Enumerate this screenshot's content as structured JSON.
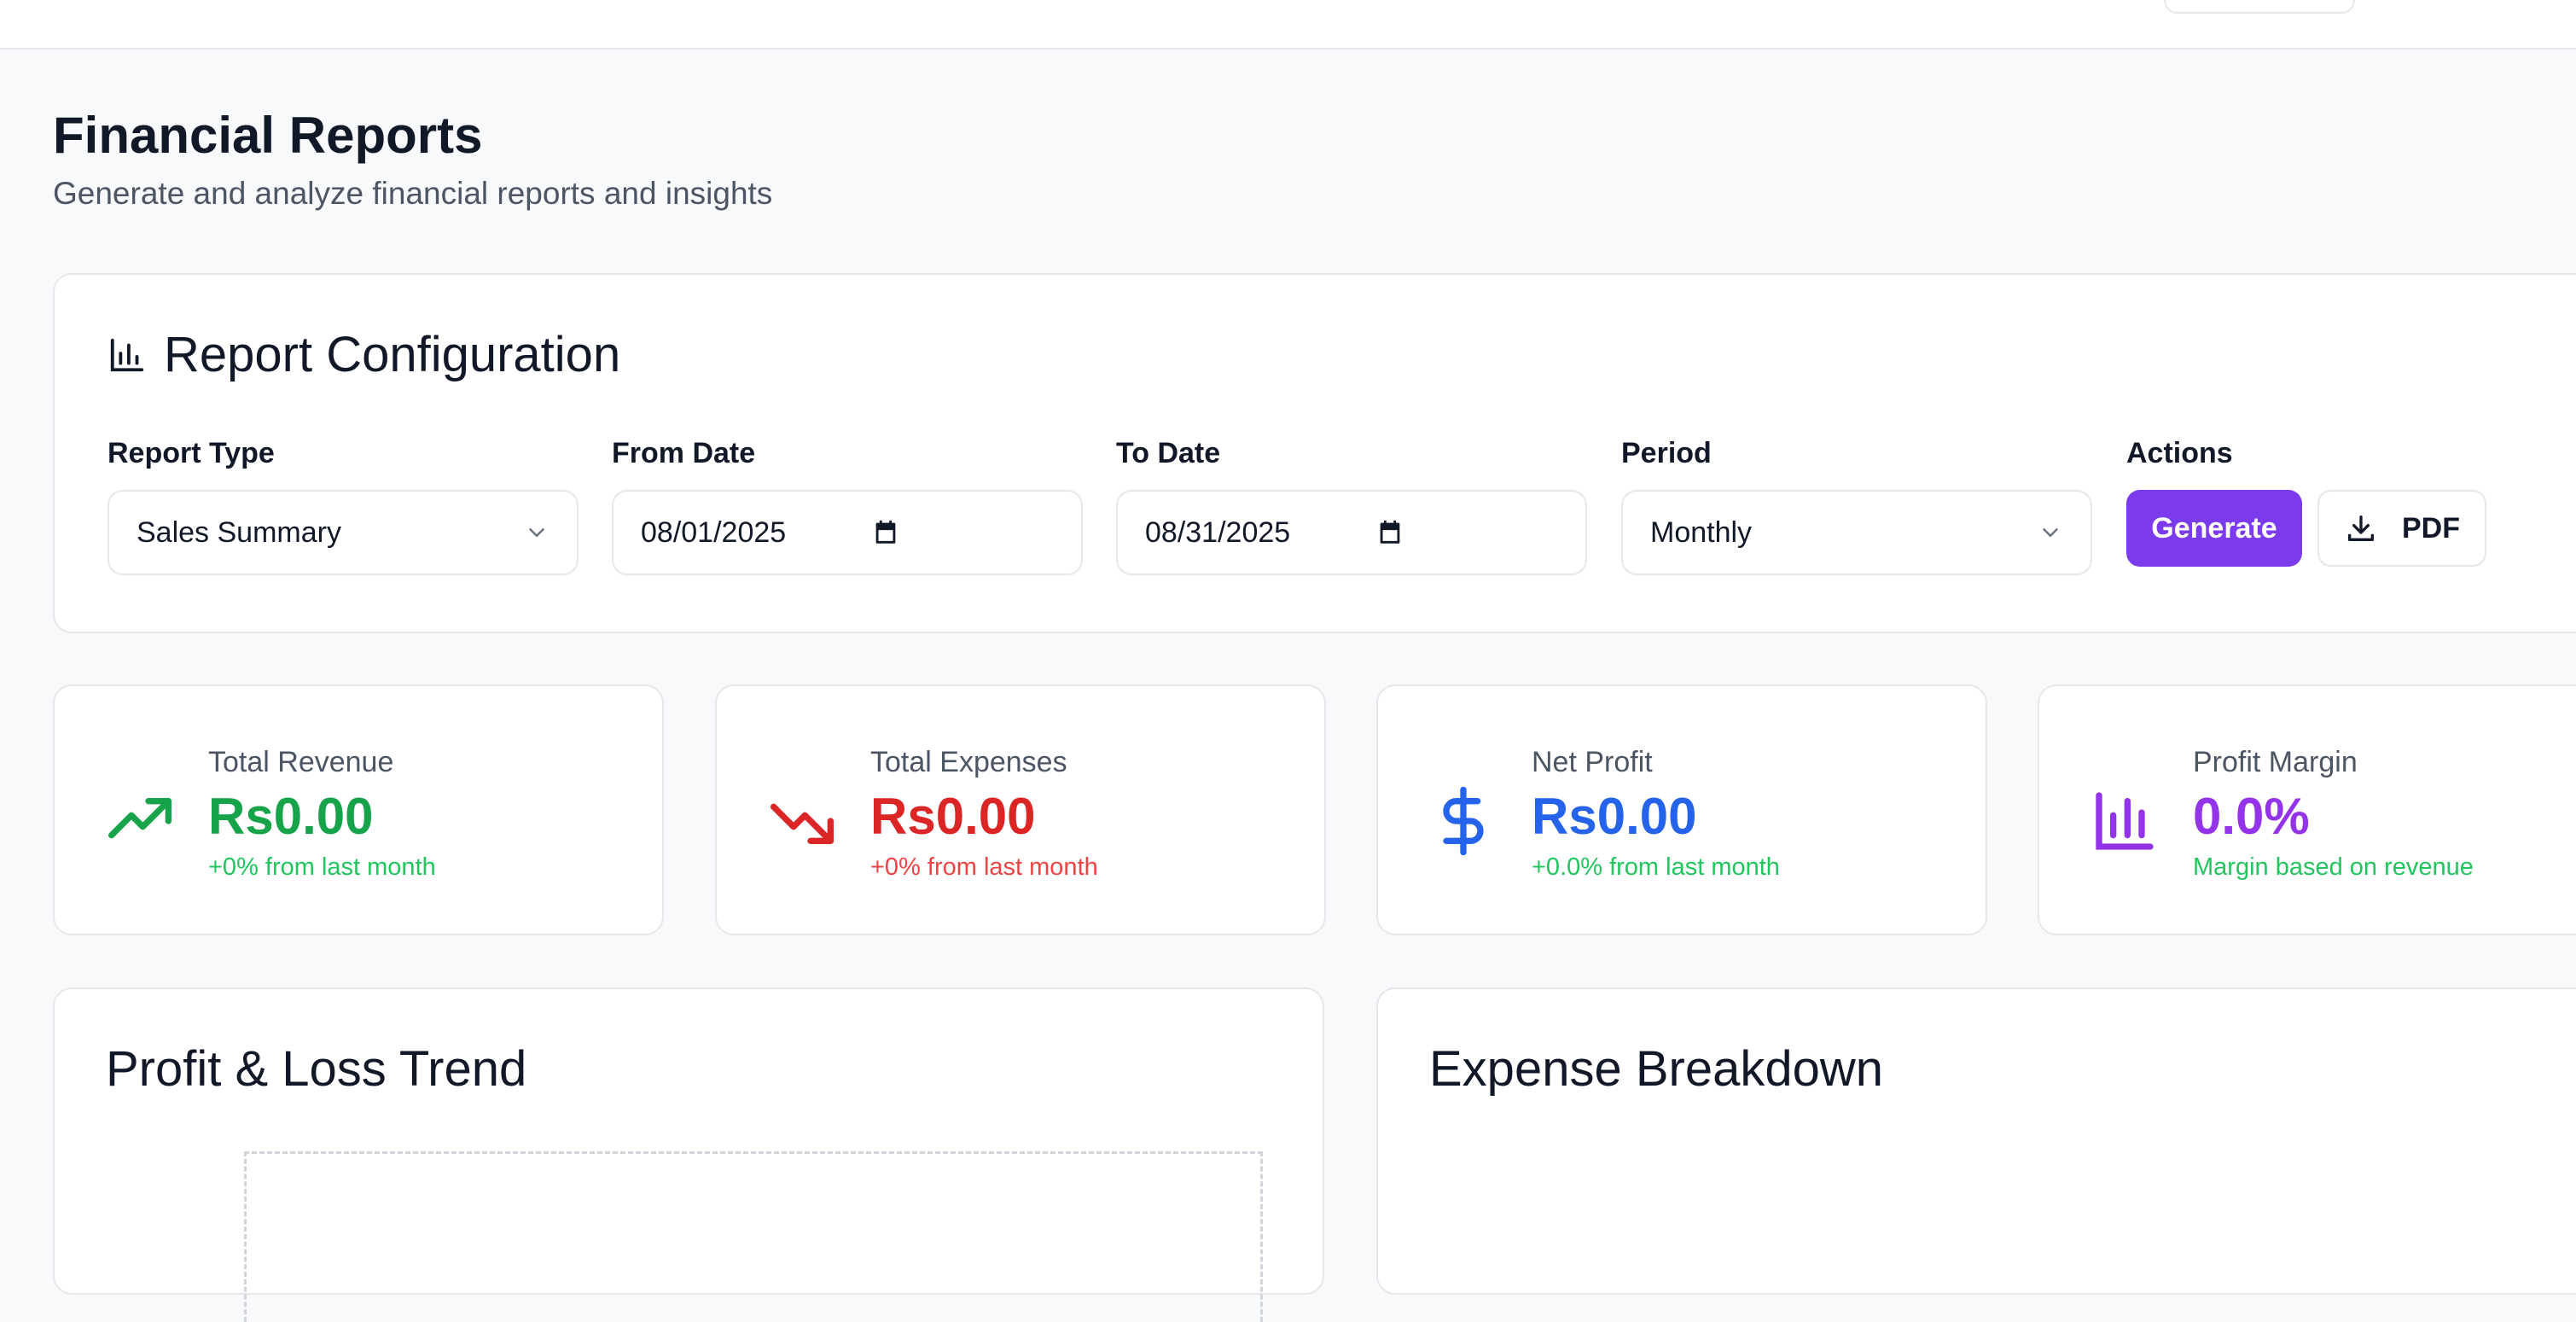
{
  "header": {
    "title": "Financial Reports",
    "subtitle": "Generate and analyze financial reports and insights"
  },
  "config": {
    "title": "Report Configuration",
    "icon": "bar-chart-icon",
    "report_type": {
      "label": "Report Type",
      "value": "Sales Summary"
    },
    "from_date": {
      "label": "From Date",
      "value": "08/01/2025"
    },
    "to_date": {
      "label": "To Date",
      "value": "08/31/2025"
    },
    "period": {
      "label": "Period",
      "value": "Monthly"
    },
    "actions": {
      "label": "Actions",
      "generate_label": "Generate",
      "pdf_label": "PDF"
    }
  },
  "stats": [
    {
      "label": "Total Revenue",
      "value": "Rs0.00",
      "note": "+0% from last month",
      "icon": "trending-up-icon",
      "color": "#16a34a",
      "note_color": "#22c55e"
    },
    {
      "label": "Total Expenses",
      "value": "Rs0.00",
      "note": "+0% from last month",
      "icon": "trending-down-icon",
      "color": "#dc2626",
      "note_color": "#ef4444"
    },
    {
      "label": "Net Profit",
      "value": "Rs0.00",
      "note": "+0.0% from last month",
      "icon": "dollar-icon",
      "color": "#2563eb",
      "note_color": "#22c55e"
    },
    {
      "label": "Profit Margin",
      "value": "0.0%",
      "note": "Margin based on revenue",
      "icon": "bar-chart-icon",
      "color": "#9333ea",
      "note_color": "#22c55e"
    }
  ],
  "charts": {
    "pl_trend_title": "Profit & Loss Trend",
    "expense_breakdown_title": "Expense Breakdown"
  },
  "colors": {
    "accent": "#7c3aed",
    "revenue": "#16a34a",
    "expenses": "#dc2626",
    "profit": "#2563eb",
    "margin": "#9333ea"
  }
}
